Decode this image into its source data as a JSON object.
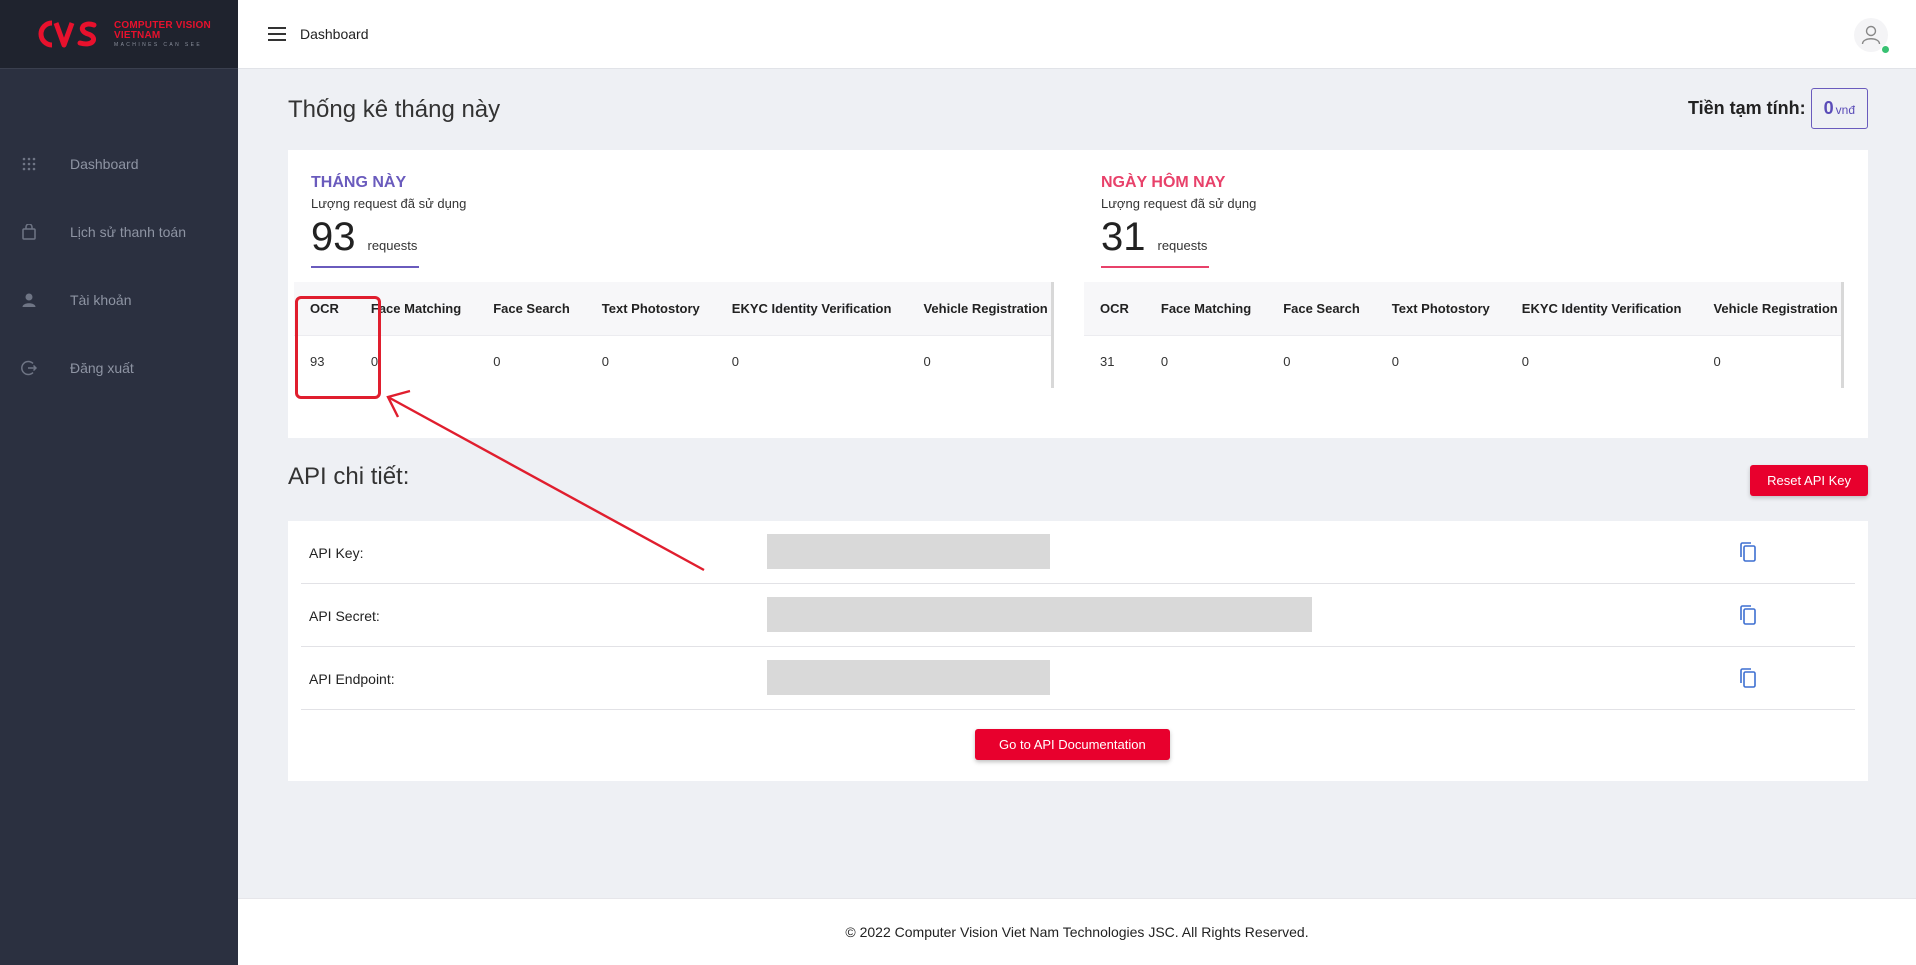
{
  "brand": {
    "line1": "COMPUTER VISION",
    "line2": "VIETNAM",
    "line3": "MACHINES CAN SEE",
    "accent": "#e8112d"
  },
  "sidebar": {
    "items": [
      {
        "label": "Dashboard",
        "icon": "grid-icon"
      },
      {
        "label": "Lịch sử thanh toán",
        "icon": "bag-icon"
      },
      {
        "label": "Tài khoản",
        "icon": "user-icon"
      },
      {
        "label": "Đăng xuất",
        "icon": "logout-icon"
      }
    ]
  },
  "topbar": {
    "title": "Dashboard"
  },
  "stats": {
    "title": "Thống kê tháng này",
    "estimate_label": "Tiền tạm tính:",
    "estimate_value": "0",
    "estimate_unit": "vnđ",
    "month": {
      "heading": "THÁNG NÀY",
      "subtitle": "Lượng request đã sử dụng",
      "count": "93",
      "unit": "requests",
      "columns": [
        "OCR",
        "Face Matching",
        "Face Search",
        "Text Photostory",
        "EKYC Identity Verification",
        "Vehicle Registration Certificate"
      ],
      "values": [
        "93",
        "0",
        "0",
        "0",
        "0",
        "0"
      ]
    },
    "today": {
      "heading": "NGÀY HÔM NAY",
      "subtitle": "Lượng request đã sử dụng",
      "count": "31",
      "unit": "requests",
      "columns": [
        "OCR",
        "Face Matching",
        "Face Search",
        "Text Photostory",
        "EKYC Identity Verification",
        "Vehicle Registration Certificate"
      ],
      "values": [
        "31",
        "0",
        "0",
        "0",
        "0",
        "0"
      ]
    }
  },
  "api": {
    "title": "API chi tiết:",
    "reset_label": "Reset API Key",
    "rows": [
      {
        "label": "API Key:"
      },
      {
        "label": "API Secret:"
      },
      {
        "label": "API Endpoint:"
      }
    ],
    "doc_label": "Go to API Documentation"
  },
  "footer": {
    "text": "© 2022 Computer Vision Viet Nam Technologies JSC. All Rights Reserved."
  },
  "colors": {
    "sidebar": "#2b3040",
    "primary_red": "#e8002d",
    "purple": "#6a5bbd",
    "pink": "#e8416a",
    "annotation": "#e01e2e"
  }
}
